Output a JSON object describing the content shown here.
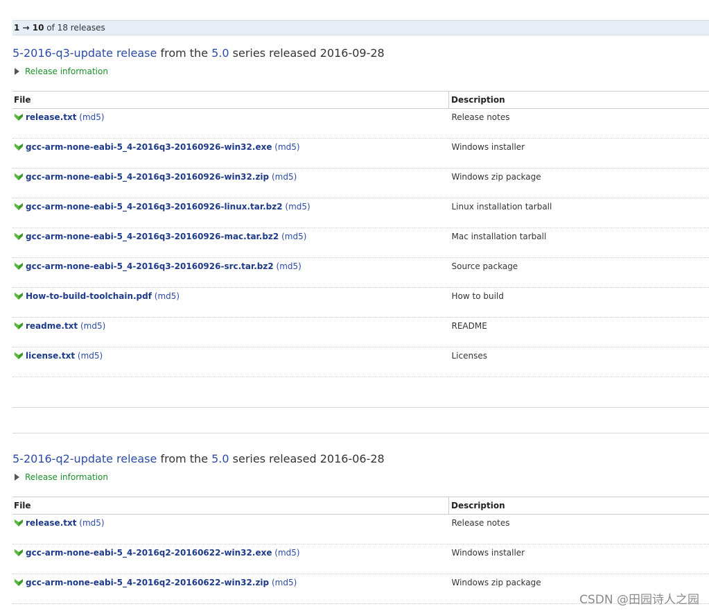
{
  "pager": {
    "range": "1 → 10",
    "suffix": "of 18 releases"
  },
  "releases": [
    {
      "name": "5-2016-q3-update release",
      "from_text": "from the",
      "series": "5.0",
      "series_text": "series released",
      "date": "2016-09-28",
      "info_label": "Release information",
      "headers": {
        "file": "File",
        "description": "Description"
      },
      "files": [
        {
          "name": "release.txt",
          "md5": "(md5)",
          "description": "Release notes"
        },
        {
          "name": "gcc-arm-none-eabi-5_4-2016q3-20160926-win32.exe",
          "md5": "(md5)",
          "description": "Windows installer"
        },
        {
          "name": "gcc-arm-none-eabi-5_4-2016q3-20160926-win32.zip",
          "md5": "(md5)",
          "description": "Windows zip package"
        },
        {
          "name": "gcc-arm-none-eabi-5_4-2016q3-20160926-linux.tar.bz2",
          "md5": "(md5)",
          "description": "Linux installation tarball"
        },
        {
          "name": "gcc-arm-none-eabi-5_4-2016q3-20160926-mac.tar.bz2",
          "md5": "(md5)",
          "description": "Mac installation tarball"
        },
        {
          "name": "gcc-arm-none-eabi-5_4-2016q3-20160926-src.tar.bz2",
          "md5": "(md5)",
          "description": "Source package"
        },
        {
          "name": "How-to-build-toolchain.pdf",
          "md5": "(md5)",
          "description": "How to build"
        },
        {
          "name": "readme.txt",
          "md5": "(md5)",
          "description": "README"
        },
        {
          "name": "license.txt",
          "md5": "(md5)",
          "description": "Licenses"
        }
      ]
    },
    {
      "name": "5-2016-q2-update release",
      "from_text": "from the",
      "series": "5.0",
      "series_text": "series released",
      "date": "2016-06-28",
      "info_label": "Release information",
      "headers": {
        "file": "File",
        "description": "Description"
      },
      "files": [
        {
          "name": "release.txt",
          "md5": "(md5)",
          "description": "Release notes"
        },
        {
          "name": "gcc-arm-none-eabi-5_4-2016q2-20160622-win32.exe",
          "md5": "(md5)",
          "description": "Windows installer"
        },
        {
          "name": "gcc-arm-none-eabi-5_4-2016q2-20160622-win32.zip",
          "md5": "(md5)",
          "description": "Windows zip package"
        }
      ]
    }
  ],
  "watermark": "CSDN @田园诗人之园",
  "colors": {
    "link": "#2a4aa6",
    "file_link": "#1e3a8a",
    "info_green": "#1b8e2a",
    "pager_bg": "#e8eef8",
    "icon_green": "#3a9a2a"
  },
  "icons": {
    "download": "download-arrow-icon",
    "disclosure": "disclosure-triangle-icon"
  }
}
